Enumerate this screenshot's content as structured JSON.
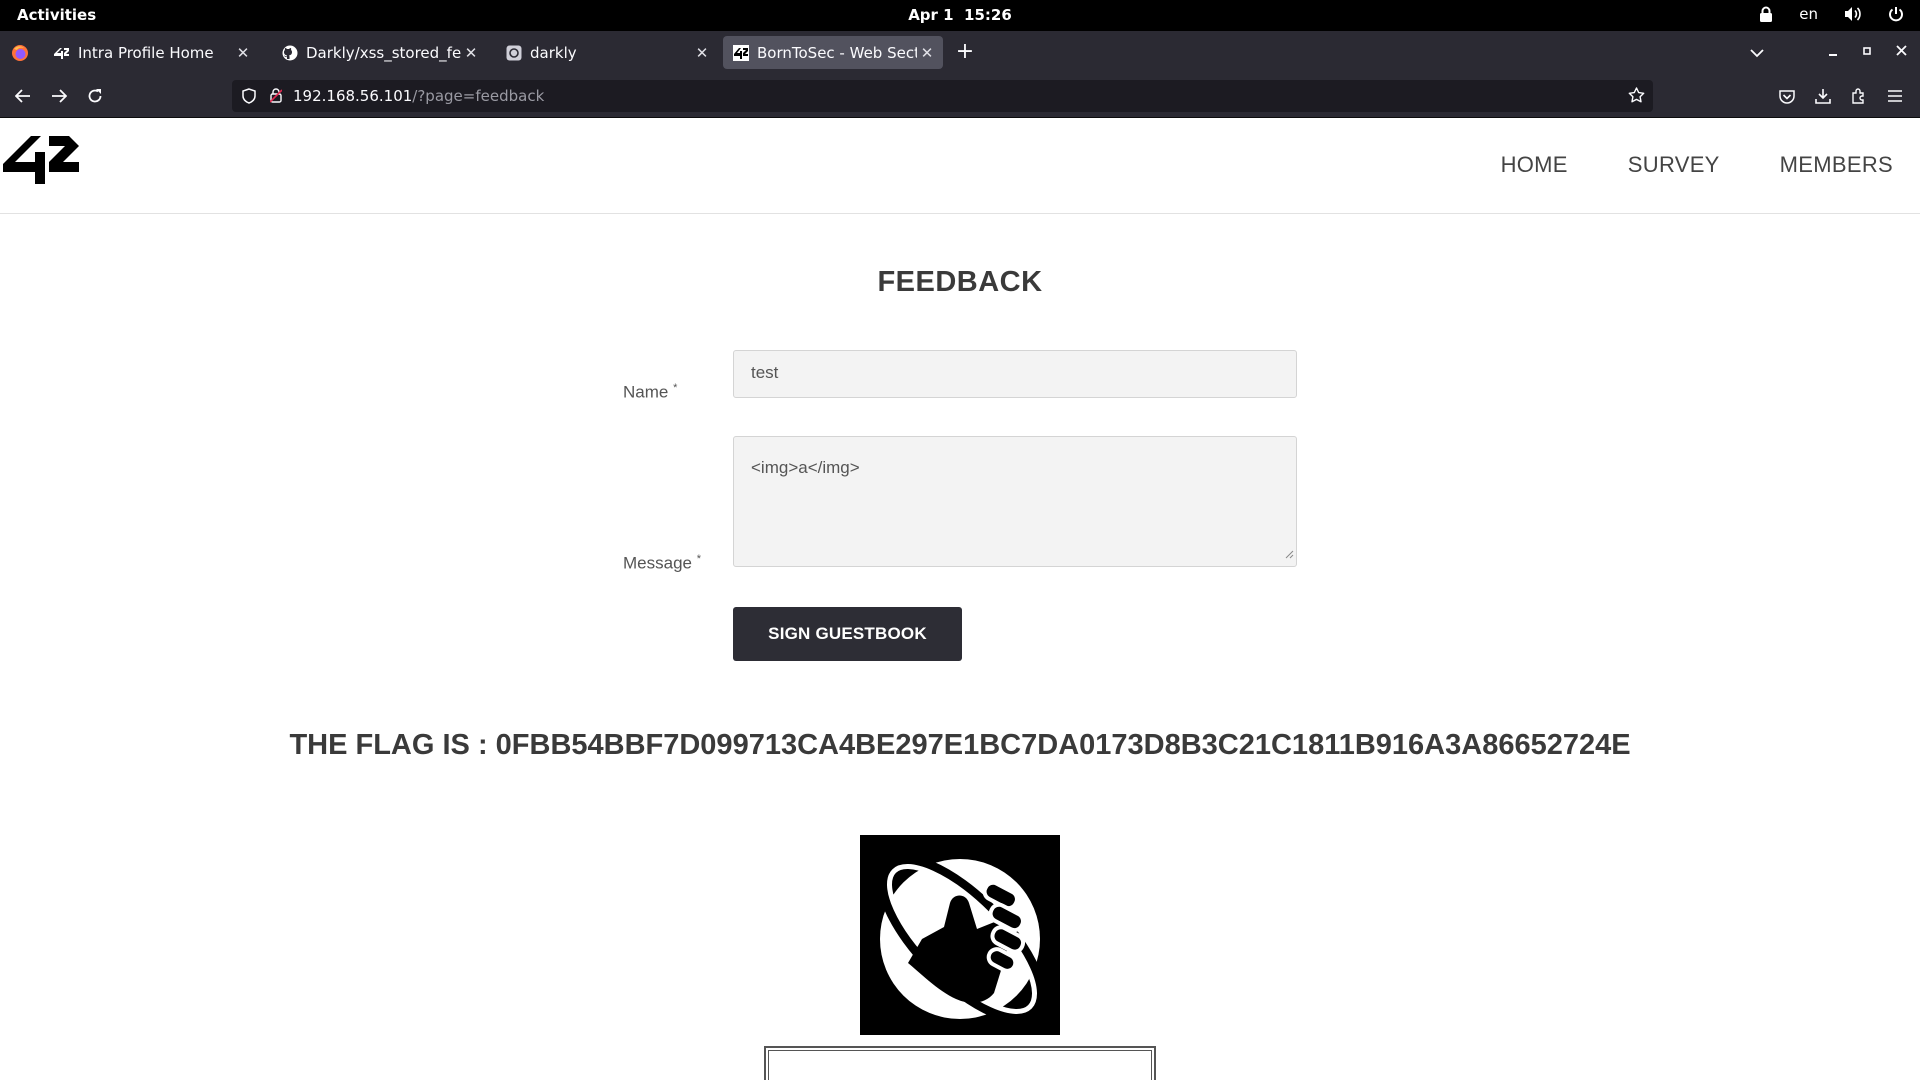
{
  "system_bar": {
    "activities": "Activities",
    "date": "Apr 1",
    "time": "15:26",
    "language": "en"
  },
  "browser": {
    "tabs": [
      {
        "title": "Intra Profile Home",
        "favicon": "42-logo-icon",
        "active": false
      },
      {
        "title": "Darkly/xss_stored_feedb",
        "favicon": "github-icon",
        "active": false
      },
      {
        "title": "darkly",
        "favicon": "chatgpt-icon",
        "active": false
      },
      {
        "title": "BornToSec - Web Section",
        "favicon": "42-logo-icon",
        "active": true
      }
    ],
    "url_host": "192.168.56.101",
    "url_path": "/?page=feedback"
  },
  "site": {
    "nav": [
      "HOME",
      "SURVEY",
      "MEMBERS"
    ],
    "title": "FEEDBACK",
    "form": {
      "name_label": "Name",
      "message_label": "Message",
      "required_mark": "*",
      "name_value": "test",
      "message_value": "<img>a</img>",
      "submit_label": "SIGN GUESTBOOK"
    },
    "flag_text": "THE FLAG IS : 0FBB54BBF7D099713CA4BE297E1BC7DA0173D8B3C21C1811B916A3A86652724E"
  },
  "colors": {
    "browser_chrome": "#2b2a33",
    "active_tab": "#52525e",
    "button_bg": "#2d2d35",
    "heading_text": "#3a3a3a"
  }
}
